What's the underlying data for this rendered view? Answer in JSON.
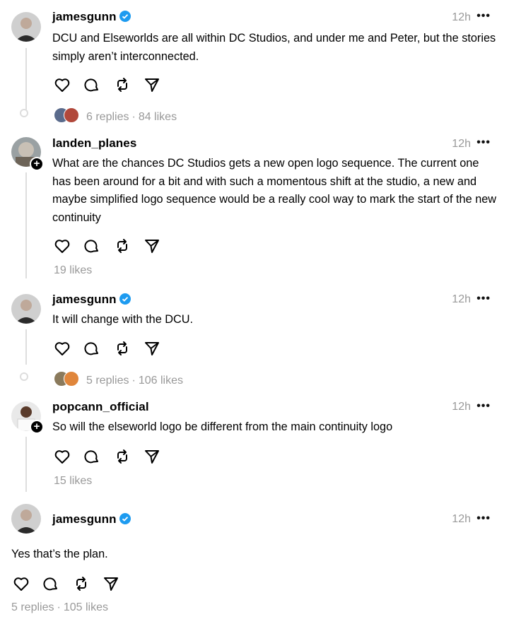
{
  "posts": [
    {
      "username": "jamesgunn",
      "verified": true,
      "time": "12h",
      "more": "•••",
      "text": "DCU and Elseworlds are all within DC Studios, and under me and Peter, but the stories simply aren’t interconnected.",
      "stats": {
        "replies": "6 replies",
        "separator": "·",
        "likes": "84 likes"
      }
    },
    {
      "username": "landen_planes",
      "verified": false,
      "time": "12h",
      "more": "•••",
      "text": "What are the chances DC Studios gets a new open logo sequence. The current one has been around for a bit and with such a momentous shift at the studio, a new and maybe simplified logo sequence would be a really cool way to mark the start of the new continuity",
      "stats": {
        "likes": "19 likes"
      }
    },
    {
      "username": "jamesgunn",
      "verified": true,
      "time": "12h",
      "more": "•••",
      "text": "It will change with the DCU.",
      "stats": {
        "replies": "5 replies",
        "separator": "·",
        "likes": "106 likes"
      }
    },
    {
      "username": "popcann_official",
      "verified": false,
      "time": "12h",
      "more": "•••",
      "text": "So will the elseworld logo be different from the main continuity logo",
      "stats": {
        "likes": "15 likes"
      }
    },
    {
      "username": "jamesgunn",
      "verified": true,
      "time": "12h",
      "more": "•••",
      "text": "Yes that’s the plan.",
      "stats": {
        "replies": "5 replies",
        "separator": "·",
        "likes": "105 likes"
      }
    }
  ],
  "icons": [
    "heart-icon",
    "comment-icon",
    "repost-icon",
    "share-icon"
  ],
  "colors": {
    "verified": "#1d9bf0",
    "muted": "#999999",
    "thread_line": "#dedede"
  }
}
